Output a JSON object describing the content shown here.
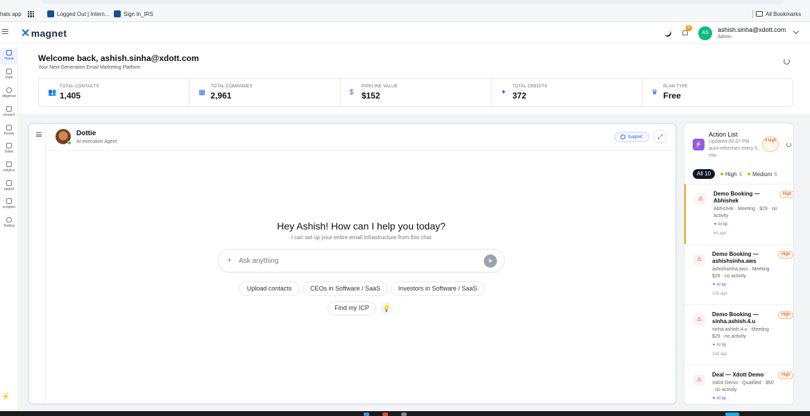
{
  "browser": {
    "bookmarks": [
      {
        "label": "hats app"
      },
      {
        "label": "Logged Out | Intern..."
      },
      {
        "label": "Sign In_IRS"
      },
      {
        "label": "All Bookmarks"
      }
    ]
  },
  "header": {
    "logo": "magnet",
    "notification_count": "8",
    "user_initials": "AS",
    "user_email": "ashish.sinha@xdott.com",
    "user_role": "Admin"
  },
  "sidebar": {
    "items": [
      {
        "label": "Home",
        "icon": "home-icon"
      },
      {
        "label": "Data",
        "icon": "database-icon"
      },
      {
        "label": "elligence",
        "icon": "bulb-icon"
      },
      {
        "label": "utreach",
        "icon": "send-icon"
      },
      {
        "label": "Assets",
        "icon": "megaphone-icon"
      },
      {
        "label": "Sales",
        "icon": "handshake-icon"
      },
      {
        "label": "nalytics",
        "icon": "bar-chart-icon"
      },
      {
        "label": "upport",
        "icon": "chat-icon"
      },
      {
        "label": "scription",
        "icon": "card-icon"
      },
      {
        "label": "Setting",
        "icon": "gear-icon"
      }
    ]
  },
  "welcome": {
    "title": "Welcome back, ashish.sinha@xdott.com",
    "subtitle": "Your Next-Generation Email Marketing Platform"
  },
  "stats": [
    {
      "label": "TOTAL CONTACTS",
      "value": "1,405",
      "icon": "users-icon"
    },
    {
      "label": "TOTAL COMPANIES",
      "value": "2,961",
      "icon": "building-icon"
    },
    {
      "label": "PIPELINE VALUE",
      "value": "$152",
      "icon": "dollar-icon"
    },
    {
      "label": "TOTAL CREDITS",
      "value": "372",
      "icon": "sparkle-icon"
    },
    {
      "label": "PLAN TYPE",
      "value": "Free",
      "icon": "crown-icon"
    }
  ],
  "chat": {
    "agent_name": "Dottie",
    "agent_role": "AI execution Agent",
    "support_label": "Support",
    "greeting": "Hey Ashish! How can I help you today?",
    "greeting_sub": "I can set up your entire email infrastructure from this chat",
    "input_placeholder": "Ask anything",
    "chips": [
      "Upload contacts",
      "CEOs in Software / SaaS",
      "Investors in Software / SaaS",
      "Find my ICP"
    ]
  },
  "action_list": {
    "title": "Action List",
    "updated": "Updated 09:37 PM · auto-refreshes every 5 min",
    "high_badge": "4 high",
    "filters": {
      "all_label": "All",
      "all_count": "10",
      "high_label": "High",
      "high_count": "4",
      "medium_label": "Medium",
      "medium_count": "6"
    },
    "items": [
      {
        "title": "Demo Booking — Abhishek",
        "priority": "High",
        "desc": "Abhishek · Meeting · $29 · no activity",
        "tip": "AI tip",
        "ago": "6d ago"
      },
      {
        "title": "Demo Booking — ashishsinha.aws",
        "priority": "High",
        "desc": "ashishsinha.aws · Meeting · $29 · no activity",
        "tip": "AI tip",
        "ago": "10d ago"
      },
      {
        "title": "Demo Booking — sinha.ashish.4.u",
        "priority": "High",
        "desc": "sinha.ashish.4.u · Meeting · $29 · no activity",
        "tip": "AI tip",
        "ago": "10d ago"
      },
      {
        "title": "Deal — Xdott Demo",
        "priority": "High",
        "desc": "Xdott Demo · Qualified · $50 · no activity",
        "tip": "AI tip",
        "ago": ""
      }
    ]
  }
}
